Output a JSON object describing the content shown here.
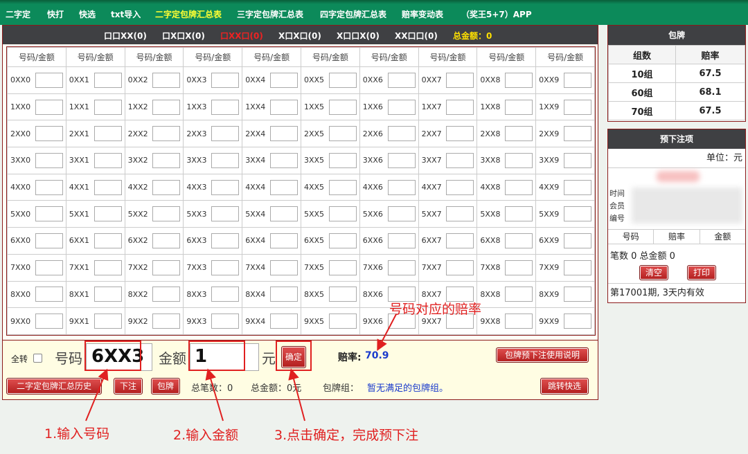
{
  "nav": [
    "二字定",
    "快打",
    "快选",
    "txt导入",
    "二字定包牌汇总表",
    "三字定包牌汇总表",
    "四字定包牌汇总表",
    "赔率变动表",
    "（奖王5+7）APP"
  ],
  "nav_active_index": 4,
  "headbar": {
    "tabs": [
      "口口XX(0)",
      "口X口X(0)",
      "口XX口(0)",
      "X口X口(0)",
      "X口口X(0)",
      "XX口口(0)"
    ],
    "active_index": 2,
    "total_label": "总金额：0"
  },
  "grid": {
    "header": "号码/金额",
    "rows": [
      [
        "0XX0",
        "0XX1",
        "0XX2",
        "0XX3",
        "0XX4",
        "0XX5",
        "0XX6",
        "0XX7",
        "0XX8",
        "0XX9"
      ],
      [
        "1XX0",
        "1XX1",
        "1XX2",
        "1XX3",
        "1XX4",
        "1XX5",
        "1XX6",
        "1XX7",
        "1XX8",
        "1XX9"
      ],
      [
        "2XX0",
        "2XX1",
        "2XX2",
        "2XX3",
        "2XX4",
        "2XX5",
        "2XX6",
        "2XX7",
        "2XX8",
        "2XX9"
      ],
      [
        "3XX0",
        "3XX1",
        "3XX2",
        "3XX3",
        "3XX4",
        "3XX5",
        "3XX6",
        "3XX7",
        "3XX8",
        "3XX9"
      ],
      [
        "4XX0",
        "4XX1",
        "4XX2",
        "4XX3",
        "4XX4",
        "4XX5",
        "4XX6",
        "4XX7",
        "4XX8",
        "4XX9"
      ],
      [
        "5XX0",
        "5XX1",
        "5XX2",
        "5XX3",
        "5XX4",
        "5XX5",
        "5XX6",
        "5XX7",
        "5XX8",
        "5XX9"
      ],
      [
        "6XX0",
        "6XX1",
        "6XX2",
        "6XX3",
        "6XX4",
        "6XX5",
        "6XX6",
        "6XX7",
        "6XX8",
        "6XX9"
      ],
      [
        "7XX0",
        "7XX1",
        "7XX2",
        "7XX3",
        "7XX4",
        "7XX5",
        "7XX6",
        "7XX7",
        "7XX8",
        "7XX9"
      ],
      [
        "8XX0",
        "8XX1",
        "8XX2",
        "8XX3",
        "8XX4",
        "8XX5",
        "8XX6",
        "8XX7",
        "8XX8",
        "8XX9"
      ],
      [
        "9XX0",
        "9XX1",
        "9XX2",
        "9XX3",
        "9XX4",
        "9XX5",
        "9XX6",
        "9XX7",
        "9XX8",
        "9XX9"
      ]
    ]
  },
  "inputbar": {
    "select_all_label": "全转",
    "number_label": "号码",
    "number_value": "6XX3",
    "amount_label": "金额",
    "amount_value": "1",
    "unit_label": "元",
    "confirm_label": "确定",
    "odds_label": "赔率:",
    "odds_value": "70.9",
    "help_button": "包牌预下注使用说明",
    "history_button": "二字定包牌汇总历史",
    "bet_button": "下注",
    "package_button": "包牌",
    "total_count": "总笔数：0",
    "total_amount": "总金额：0元",
    "group_label": "包牌组：",
    "group_value": "暂无满足的包牌组。",
    "jump_button": "跳转快选"
  },
  "side_package": {
    "title": "包牌",
    "headers": [
      "组数",
      "赔率"
    ],
    "rows": [
      [
        "10组",
        "67.5"
      ],
      [
        "60组",
        "68.1"
      ],
      [
        "70组",
        "67.5"
      ]
    ]
  },
  "side_bets": {
    "title": "预下注项",
    "unit": "单位：元",
    "time_label": "时间",
    "member_label": "会员",
    "id_label": "编号",
    "columns": [
      "号码",
      "赔率",
      "金额"
    ],
    "summary": "笔数 0 总金额 0",
    "clear_button": "清空",
    "print_button": "打印",
    "validity": "第17001期, 3天内有效"
  },
  "annotations": {
    "odds_note": "号码对应的赔率",
    "step1": "1.输入号码",
    "step2": "2.输入金额",
    "step3": "3.点击确定，完成预下注"
  },
  "colors": {
    "nav_bg": "#0c8a5a",
    "header_bg": "#3f4043",
    "accent_red": "#e02020",
    "odds_blue": "#1a3acc"
  }
}
